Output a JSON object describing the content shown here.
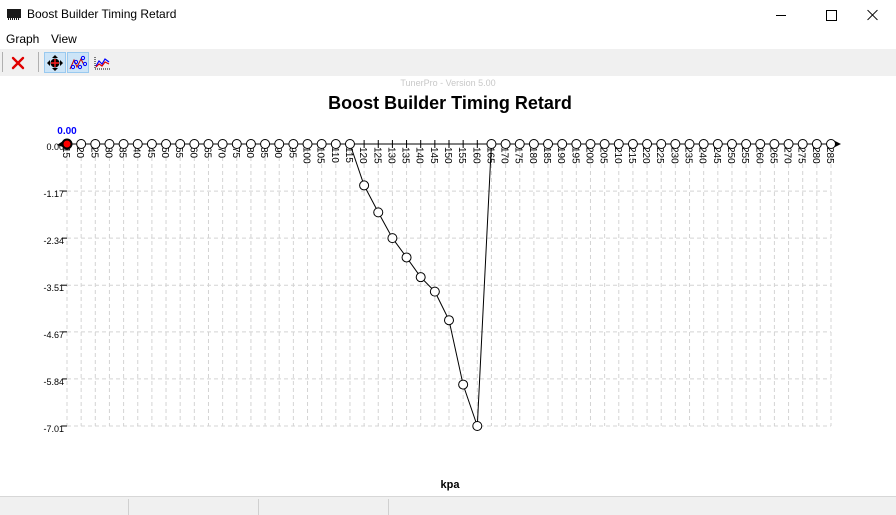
{
  "window": {
    "title": "Boost Builder Timing Retard",
    "icon": "chip-icon",
    "controls": [
      "minimize",
      "maximize",
      "close"
    ]
  },
  "menu": {
    "items": [
      {
        "label": "Graph"
      },
      {
        "label": "View"
      }
    ]
  },
  "toolbar": {
    "buttons": [
      {
        "name": "close-graph",
        "icon": "red-x-icon",
        "active": false
      },
      {
        "name": "move-point",
        "icon": "crosshair-move-icon",
        "active": true
      },
      {
        "name": "point-edit",
        "icon": "point-curve-icon",
        "active": true
      },
      {
        "name": "line-graph",
        "icon": "line-graph-icon",
        "active": false
      }
    ]
  },
  "watermark": "TunerPro - Version 5.00",
  "selected_value": "0.00",
  "colors": {
    "selected_point": "#ff0000",
    "selected_value_label": "#0000ff",
    "grid": "#d4d4d4",
    "line": "#000000"
  },
  "chart_data": {
    "type": "line",
    "title": "Boost Builder Timing Retard",
    "xlabel": "kpa",
    "ylabel": "",
    "x_axis_position": "top",
    "x_tick_labels_rotated": true,
    "grid": true,
    "x": [
      15,
      20,
      25,
      30,
      35,
      40,
      45,
      50,
      55,
      60,
      65,
      70,
      75,
      80,
      85,
      90,
      95,
      100,
      105,
      110,
      115,
      120,
      125,
      130,
      135,
      140,
      145,
      150,
      155,
      160,
      165,
      170,
      175,
      180,
      185,
      190,
      195,
      200,
      205,
      210,
      215,
      220,
      225,
      230,
      235,
      240,
      245,
      250,
      255,
      260,
      265,
      270,
      275,
      280,
      285
    ],
    "x_tick_labels": [
      "15",
      "20",
      "25",
      "30",
      "35",
      "40",
      "45",
      "50",
      "55",
      "60",
      "65",
      "70",
      "75",
      "80",
      "85",
      "90",
      "95",
      "100",
      "105",
      "110",
      "115",
      "120",
      "125",
      "130",
      "135",
      "140",
      "145",
      "150",
      "155",
      "160",
      "165",
      "170",
      "175",
      "180",
      "185",
      "190",
      "195",
      "200",
      "205",
      "210",
      "215",
      "220",
      "225",
      "230",
      "235",
      "240",
      "245",
      "250",
      "255",
      "260",
      "265",
      "270",
      "275",
      "280",
      "285"
    ],
    "series": [
      {
        "name": "Timing Retard",
        "values": [
          0,
          0,
          0,
          0,
          0,
          0,
          0,
          0,
          0,
          0,
          0,
          0,
          0,
          0,
          0,
          0,
          0,
          0,
          0,
          0,
          0,
          -1.03,
          -1.7,
          -2.34,
          -2.82,
          -3.31,
          -3.67,
          -4.38,
          -5.98,
          -7.01,
          0,
          0,
          0,
          0,
          0,
          0,
          0,
          0,
          0,
          0,
          0,
          0,
          0,
          0,
          0,
          0,
          0,
          0,
          0,
          0,
          0,
          0,
          0,
          0,
          0
        ]
      }
    ],
    "y_tick_labels": [
      "0.00",
      "-1.17",
      "-2.34",
      "-3.51",
      "-4.67",
      "-5.84",
      "-7.01"
    ],
    "y_ticks": [
      0,
      -1.17,
      -2.34,
      -3.51,
      -4.67,
      -5.84,
      -7.01
    ],
    "ylim": [
      -7.01,
      0
    ],
    "xlim": [
      15,
      285
    ],
    "selected_index": 0
  },
  "statusbar": {
    "panes": [
      "",
      "",
      "",
      ""
    ]
  }
}
